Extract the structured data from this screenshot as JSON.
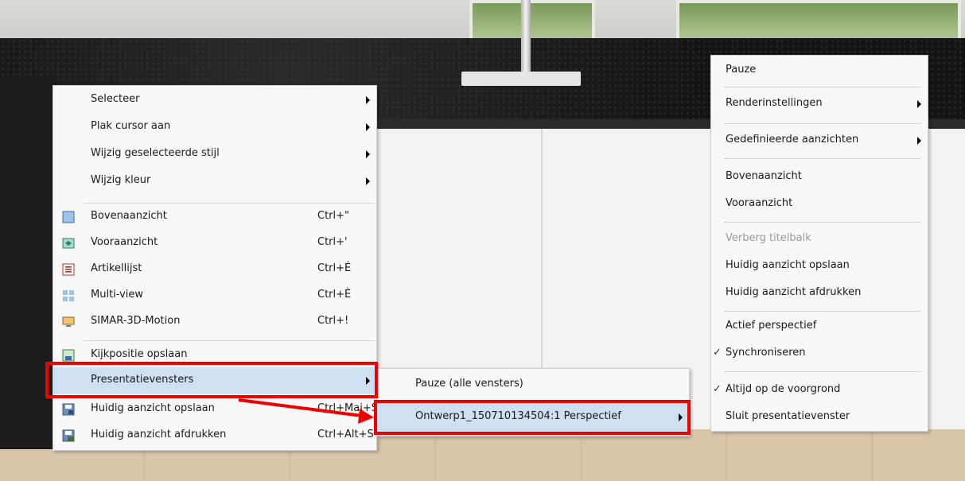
{
  "context_menu": {
    "items": [
      {
        "label": "Selecteer",
        "icon": null,
        "shortcut": "",
        "submenu": true
      },
      {
        "label": "Plak cursor aan",
        "icon": null,
        "shortcut": "",
        "submenu": true
      },
      {
        "label": "Wijzig geselecteerde stijl",
        "icon": null,
        "shortcut": "",
        "submenu": true
      },
      {
        "label": "Wijzig kleur",
        "icon": null,
        "shortcut": "",
        "submenu": true
      },
      {
        "label": "Bovenaanzicht",
        "icon": "top-view-icon",
        "shortcut": "Ctrl+\"",
        "submenu": false
      },
      {
        "label": "Vooraanzicht",
        "icon": "front-view-icon",
        "shortcut": "Ctrl+'",
        "submenu": false
      },
      {
        "label": "Artikellijst",
        "icon": "article-list-icon",
        "shortcut": "Ctrl+É",
        "submenu": false
      },
      {
        "label": "Multi-view",
        "icon": "multi-view-icon",
        "shortcut": "Ctrl+È",
        "submenu": false
      },
      {
        "label": "SIMAR-3D-Motion",
        "icon": "monitor-icon",
        "shortcut": "Ctrl+!",
        "submenu": false
      },
      {
        "label": "Kijkpositie opslaan",
        "icon": "save-viewpoint-icon",
        "shortcut": "",
        "submenu": false
      },
      {
        "label": "Presentatievensters",
        "icon": null,
        "shortcut": "",
        "submenu": true,
        "highlighted": true
      },
      {
        "label": "Huidig aanzicht opslaan",
        "icon": "save-view-icon",
        "shortcut": "Ctrl+Maj+S",
        "submenu": false
      },
      {
        "label": "Huidig aanzicht afdrukken",
        "icon": "print-view-icon",
        "shortcut": "Ctrl+Alt+S",
        "submenu": false
      }
    ]
  },
  "submenu_presentation": {
    "items": [
      {
        "label": "Pauze (alle vensters)",
        "submenu": false
      },
      {
        "label": "Ontwerp1_150710134504:1 Perspectief",
        "submenu": true,
        "highlighted": true
      }
    ]
  },
  "window_menu": {
    "items": [
      {
        "label": "Pauze",
        "submenu": false,
        "disabled": false,
        "checked": false
      },
      {
        "label": "Renderinstellingen",
        "submenu": true,
        "disabled": false,
        "checked": false
      },
      {
        "label": "Gedefinieerde aanzichten",
        "submenu": true,
        "disabled": false,
        "checked": false
      },
      {
        "label": "Bovenaanzicht",
        "submenu": false,
        "disabled": false,
        "checked": false
      },
      {
        "label": "Vooraanzicht",
        "submenu": false,
        "disabled": false,
        "checked": false
      },
      {
        "label": "Verberg titelbalk",
        "submenu": false,
        "disabled": true,
        "checked": false
      },
      {
        "label": "Huidig aanzicht opslaan",
        "submenu": false,
        "disabled": false,
        "checked": false
      },
      {
        "label": "Huidig aanzicht afdrukken",
        "submenu": false,
        "disabled": false,
        "checked": false
      },
      {
        "label": "Actief perspectief",
        "submenu": false,
        "disabled": false,
        "checked": false
      },
      {
        "label": "Synchroniseren",
        "submenu": false,
        "disabled": false,
        "checked": true
      },
      {
        "label": "Altijd op de voorgrond",
        "submenu": false,
        "disabled": false,
        "checked": true
      },
      {
        "label": "Sluit presentatievenster",
        "submenu": false,
        "disabled": false,
        "checked": false
      }
    ],
    "check_glyph": "✓"
  },
  "colors": {
    "highlight": "#cfe0f3",
    "annotation_red": "#ee0000",
    "disabled_text": "#9a9a9a"
  }
}
